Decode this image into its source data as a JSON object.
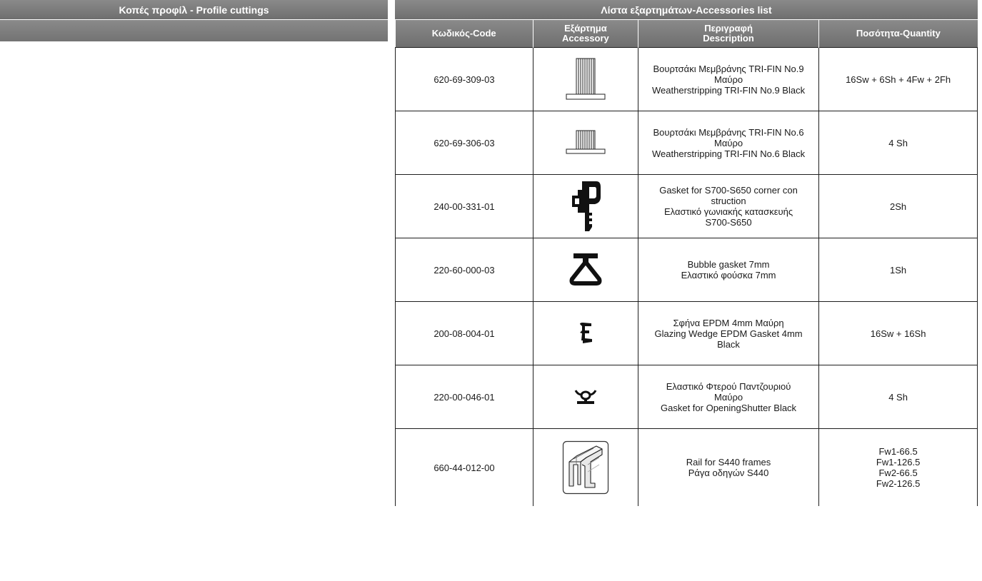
{
  "left_panel": {
    "title": "Κοπές προφίλ - Profile cuttings"
  },
  "accessories": {
    "title": "Λίστα εξαρτημάτων-Accessories list",
    "headers": {
      "code": "Κωδικός-Code",
      "accessory_gr": "Εξάρτημα",
      "accessory_en": "Accessory",
      "description_gr": "Περιγραφή",
      "description_en": "Description",
      "quantity": "Ποσότητα-Quantity"
    },
    "rows": [
      {
        "code": "620-69-309-03",
        "icon": "brush-seal-tall-icon",
        "description": [
          "Βουρτσάκι Μεμβράνης TRI-FIN No.9",
          "Μαύρο",
          "Weatherstripping TRI-FIN No.9 Black"
        ],
        "quantity": [
          "16Sw + 6Sh + 4Fw + 2Fh"
        ]
      },
      {
        "code": "620-69-306-03",
        "icon": "brush-seal-short-icon",
        "description": [
          "Βουρτσάκι Μεμβράνης TRI-FIN No.6",
          "Μαύρο",
          "Weatherstripping TRI-FIN No.6 Black"
        ],
        "quantity": [
          "4 Sh"
        ]
      },
      {
        "code": "240-00-331-01",
        "icon": "corner-gasket-icon",
        "description": [
          "Gasket for S700-S650 corner con",
          "struction",
          "Ελαστικό γωνιακής κατασκευής",
          "S700-S650"
        ],
        "quantity": [
          "2Sh"
        ]
      },
      {
        "code": "220-60-000-03",
        "icon": "bubble-gasket-icon",
        "description": [
          "Bubble gasket 7mm",
          "Ελαστικό φούσκα 7mm"
        ],
        "quantity": [
          "1Sh"
        ]
      },
      {
        "code": "200-08-004-01",
        "icon": "glazing-wedge-icon",
        "description": [
          "Σφήνα EPDM 4mm Μαύρη",
          "Glazing Wedge EPDM Gasket 4mm",
          "Black"
        ],
        "quantity": [
          "16Sw + 16Sh"
        ]
      },
      {
        "code": "220-00-046-01",
        "icon": "shutter-gasket-icon",
        "description": [
          "Ελαστικό Φτερού Παντζουριού",
          "Μαύρο",
          "Gasket for OpeningShutter Black"
        ],
        "quantity": [
          "4 Sh"
        ]
      },
      {
        "code": "660-44-012-00",
        "icon": "rail-profile-icon",
        "description": [
          "Rail for S440 frames",
          "Ράγα οδηγών S440"
        ],
        "quantity": [
          "Fw1-66.5",
          "Fw1-126.5",
          "Fw2-66.5",
          "Fw2-126.5"
        ]
      }
    ]
  },
  "colors": {
    "header_bg": "#7a7a7a",
    "header_text": "#ffffff",
    "border": "#1e1e1e"
  }
}
